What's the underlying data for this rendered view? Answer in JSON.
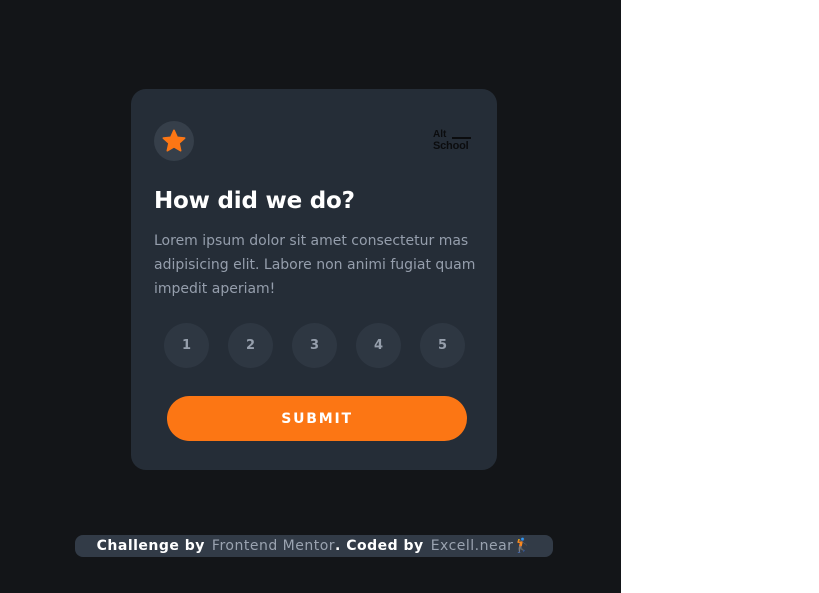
{
  "card": {
    "title": "How did we do?",
    "description": "Lorem ipsum dolor sit amet consectetur mas adipisicing elit. Labore non animi fugiat quam impedit aperiam!",
    "star_icon": "star-icon",
    "logo": {
      "line1": "Alt",
      "line2": "School"
    },
    "ratings": [
      "1",
      "2",
      "3",
      "4",
      "5"
    ],
    "submit_label": "SUBMIT"
  },
  "attribution": {
    "prefix": "Challenge by",
    "challenge_link": "Frontend Mentor",
    "middle": ". Coded by",
    "author_link": "Excell.near",
    "author_emoji": "🏌"
  },
  "colors": {
    "background": "#131518",
    "card": "#252d37",
    "accent": "#fc7614",
    "rating_button": "#2e3742",
    "muted_text": "#959eac"
  }
}
